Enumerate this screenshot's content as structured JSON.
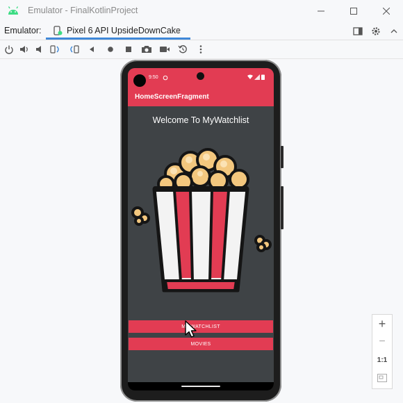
{
  "window": {
    "title": "Emulator - FinalKotlinProject",
    "logo_icon": "android-icon",
    "controls": [
      "minimize-icon",
      "maximize-icon",
      "close-icon"
    ]
  },
  "tabbar": {
    "emulator_label": "Emulator:",
    "device_tab": {
      "label": "Pixel 6 API UpsideDownCake",
      "close": "×"
    }
  },
  "toolbar": {
    "tools": [
      "power-icon",
      "volume-up-icon",
      "volume-down-icon",
      "rotate-left-icon",
      "rotate-right-icon",
      "back-icon",
      "home-icon",
      "overview-icon",
      "camera-icon",
      "record-icon",
      "snapshot-icon",
      "more-icon"
    ]
  },
  "device": {
    "status_time": "9:50",
    "appbar_title": "HomeScreenFragment",
    "welcome_text": "Welcome To MyWatchlist",
    "buttons": {
      "watchlist": "MY WATCHLIST",
      "movies": "MOVIES"
    }
  },
  "zoom_panel": {
    "zoom_in": "+",
    "zoom_out": "−",
    "one_to_one": "1:1"
  },
  "colors": {
    "accent": "#e23c53",
    "screen_bg": "#3f4346",
    "tab_accent": "#3f88d8"
  }
}
